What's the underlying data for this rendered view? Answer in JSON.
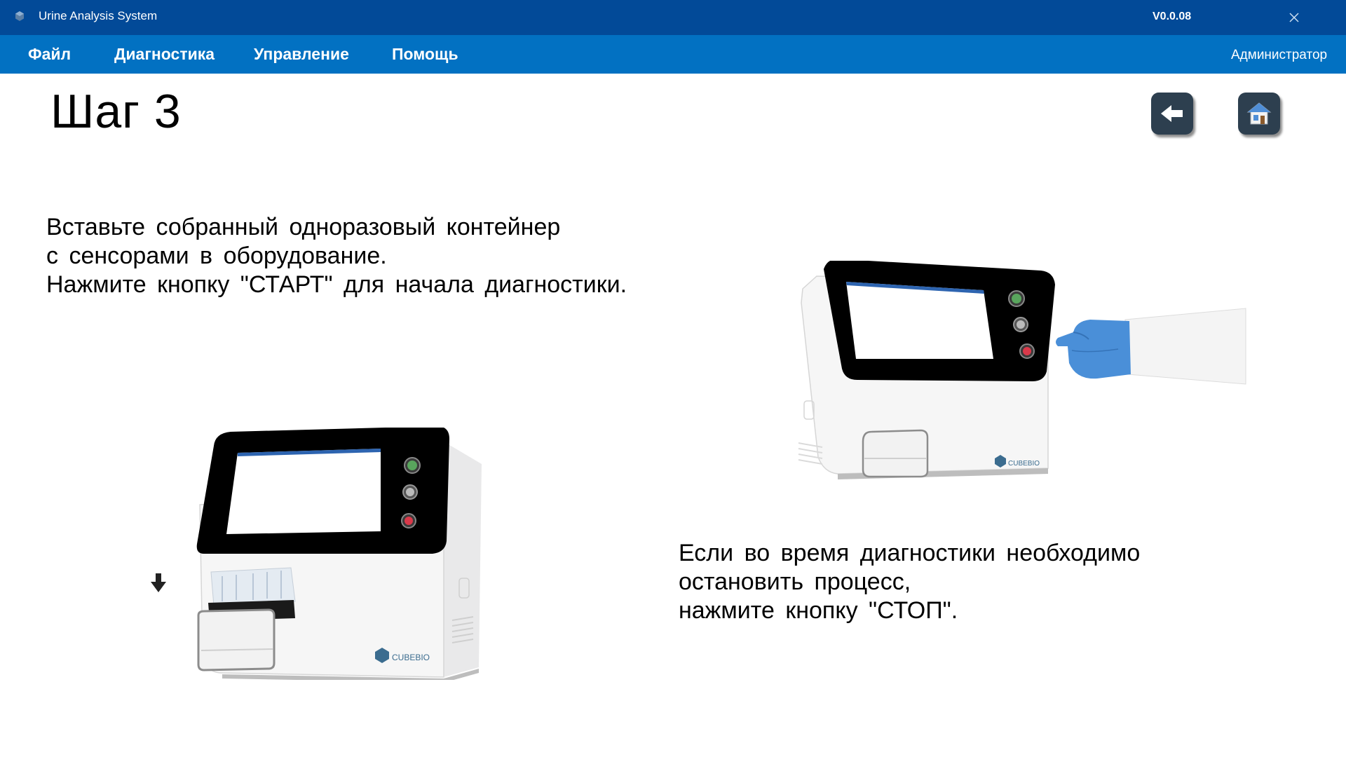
{
  "window": {
    "title": "Urine Analysis System",
    "version": "V0.0.08",
    "icons": {
      "app": "app-logo-icon",
      "close": "close-icon"
    }
  },
  "menu": {
    "items": [
      {
        "label": "Файл"
      },
      {
        "label": "Диагностика"
      },
      {
        "label": "Управление"
      },
      {
        "label": "Помощь"
      }
    ],
    "user": "Администратор"
  },
  "page": {
    "title": "Шаг 3",
    "buttons": {
      "back_icon": "arrow-left-icon",
      "home_icon": "home-icon"
    },
    "instructions_start": [
      "Вставьте собранный одноразовый контейнер",
      "с сенсорами в оборудование.",
      "Нажмите кнопку \"СТАРТ\" для начала диагностики."
    ],
    "instructions_stop": [
      "Если во время диагностики необходимо",
      "остановить процесс,",
      "нажмите кнопку \"СТОП\"."
    ],
    "device_brand": "CUBEBIO"
  },
  "colors": {
    "titlebar": "#024a98",
    "menubar": "#0271c2",
    "nav_button": "#2d3f4f",
    "glove": "#4a8fd8",
    "start_button": "#59a55d",
    "stop_button": "#d9394a"
  }
}
